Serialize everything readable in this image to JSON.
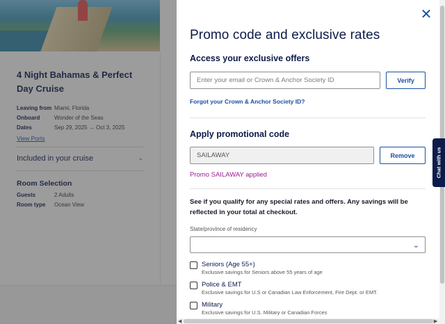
{
  "trip": {
    "title": "4 Night Bahamas & Perfect Day Cruise",
    "details": [
      {
        "label": "Leaving from",
        "value": "Miami, Florida"
      },
      {
        "label": "Onboard",
        "value": "Wonder of the Seas"
      },
      {
        "label": "Dates",
        "value": "Sep 29, 2025  →  Oct 3, 2025"
      }
    ],
    "view_ports_link": "View Ports",
    "included_label": "Included in your cruise",
    "room_heading": "Room Selection",
    "room_details": [
      {
        "label": "Guests",
        "value": "2 Adults"
      },
      {
        "label": "Room type",
        "value": "Ocean View"
      }
    ]
  },
  "modal": {
    "title": "Promo code and exclusive rates",
    "close_icon": "close-icon",
    "exclusive": {
      "heading": "Access your exclusive offers",
      "input_placeholder": "Enter your email or Crown & Anchor Society ID",
      "verify_label": "Verify",
      "forgot_link": "Forgot your Crown & Anchor Society ID?"
    },
    "promo": {
      "heading": "Apply promotional code",
      "code_value": "SAILAWAY",
      "remove_label": "Remove",
      "applied_text": "Promo SAILAWAY applied",
      "applied_color": "#9a1d8f"
    },
    "special": {
      "info_text": "See if you qualify for any special rates and offers. Any savings will be reflected in your total at checkout.",
      "residency_label": "State/province of residency",
      "residency_value": "",
      "options": [
        {
          "title": "Seniors (Age 55+)",
          "desc": "Exclusive savings for Seniors above 55 years of age",
          "checked": false
        },
        {
          "title": "Police & EMT",
          "desc": "Exclusive savings for U.S or Canadian Law Enforcement, Fire Dept. or EMT.",
          "checked": false
        },
        {
          "title": "Military",
          "desc": "Exclusive savings for U.S. Military or Canadian Forces",
          "checked": false
        }
      ]
    }
  },
  "chat_tab_label": "Chat with us",
  "colors": {
    "brand_navy": "#0d1b4a",
    "link_blue": "#1a4fa0"
  }
}
